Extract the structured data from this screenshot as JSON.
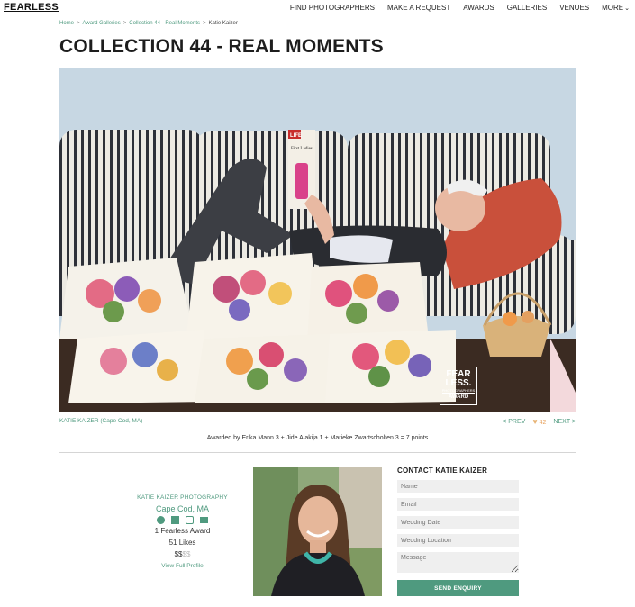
{
  "header": {
    "logo": "FEARLESS",
    "nav": [
      {
        "label": "FIND PHOTOGRAPHERS"
      },
      {
        "label": "MAKE A REQUEST"
      },
      {
        "label": "AWARDS"
      },
      {
        "label": "GALLERIES"
      },
      {
        "label": "VENUES"
      },
      {
        "label": "MORE"
      }
    ]
  },
  "breadcrumb": {
    "items": [
      "Home",
      "Award Galleries",
      "Collection 44 - Real Moments"
    ],
    "current": "Katie Kaizer",
    "separator": ">"
  },
  "page": {
    "title": "COLLECTION 44 - REAL MOMENTS"
  },
  "photo": {
    "badge_top": "FEAR LESS.",
    "badge_mid": "PHOTOGRAPHERS",
    "badge_bottom": "AWARD",
    "magazine": "LIFE",
    "magazine_cover": "First Ladies"
  },
  "photo_meta": {
    "photographer": "KATIE KAIZER (Cape Cod, MA)",
    "prev": "< PREV",
    "likes": "42",
    "next": "NEXT >",
    "awarded": "Awarded by Erika Mann 3 + Jide Alakija 1 + Marieke Zwartscholten 3 = 7 points"
  },
  "profile": {
    "studio": "KATIE KAIZER PHOTOGRAPHY",
    "location": "Cape Cod, MA",
    "awards": "1 Fearless Award",
    "likes": "51 Likes",
    "price_active": "$$",
    "price_inactive": "$$",
    "view_link": "View Full Profile",
    "icons": [
      "globe-icon",
      "facebook-icon",
      "instagram-icon",
      "mail-icon"
    ]
  },
  "contact": {
    "heading": "CONTACT KATIE KAIZER",
    "fields": {
      "name": "Name",
      "email": "Email",
      "date": "Wedding Date",
      "location": "Wedding Location",
      "message": "Message"
    },
    "submit": "SEND ENQUIRY"
  },
  "colors": {
    "accent": "#4f9a7f",
    "heart": "#e7b374"
  }
}
